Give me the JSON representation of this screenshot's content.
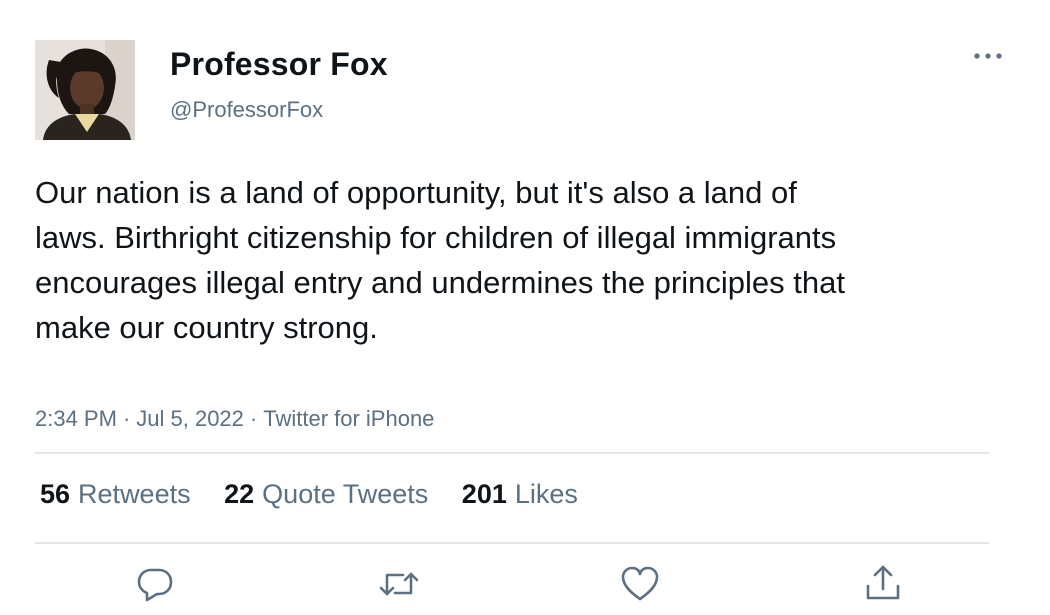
{
  "author": {
    "display_name": "Professor Fox",
    "handle": "@ProfessorFox",
    "avatar_icon": "profile-photo"
  },
  "tweet": {
    "text": "Our nation is a land of opportunity, but it's also a land of laws. Birthright citizenship for children of illegal immigrants encourages illegal entry and undermines the principles that make our country strong.",
    "time": "2:34 PM",
    "date": "Jul 5, 2022",
    "separator": "·",
    "source": "Twitter for iPhone"
  },
  "stats": {
    "retweets": {
      "count": "56",
      "label": "Retweets"
    },
    "quote_tweets": {
      "count": "22",
      "label": "Quote Tweets"
    },
    "likes": {
      "count": "201",
      "label": "Likes"
    }
  },
  "actions": {
    "reply_icon": "reply-icon",
    "retweet_icon": "retweet-icon",
    "like_icon": "heart-icon",
    "share_icon": "share-icon",
    "more_icon": "more-icon"
  },
  "colors": {
    "text": "#0f1419",
    "secondary": "#5b7083",
    "divider": "#e1e6ea"
  }
}
